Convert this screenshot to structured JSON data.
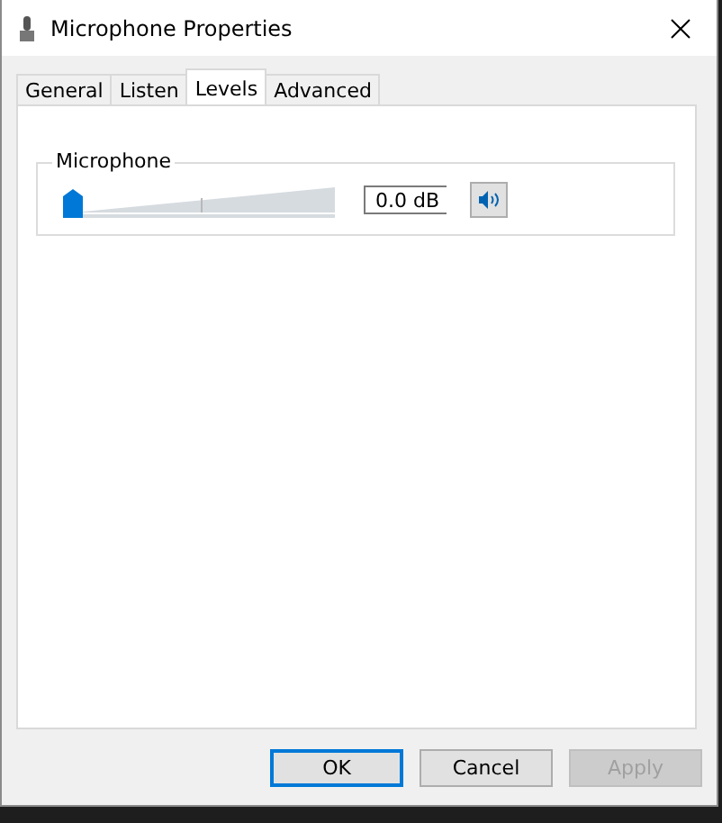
{
  "window": {
    "title": "Microphone Properties"
  },
  "tabs": [
    {
      "label": "General",
      "selected": false
    },
    {
      "label": "Listen",
      "selected": false
    },
    {
      "label": "Levels",
      "selected": true
    },
    {
      "label": "Advanced",
      "selected": false
    }
  ],
  "levels": [
    {
      "name": "Microphone",
      "level": 0,
      "reading": "0.0 dB",
      "muted": false
    }
  ],
  "buttons": [
    {
      "label": "OK",
      "default": true,
      "disabled": false
    },
    {
      "label": "Cancel",
      "default": false,
      "disabled": false
    },
    {
      "label": "Apply",
      "default": false,
      "disabled": true
    }
  ]
}
